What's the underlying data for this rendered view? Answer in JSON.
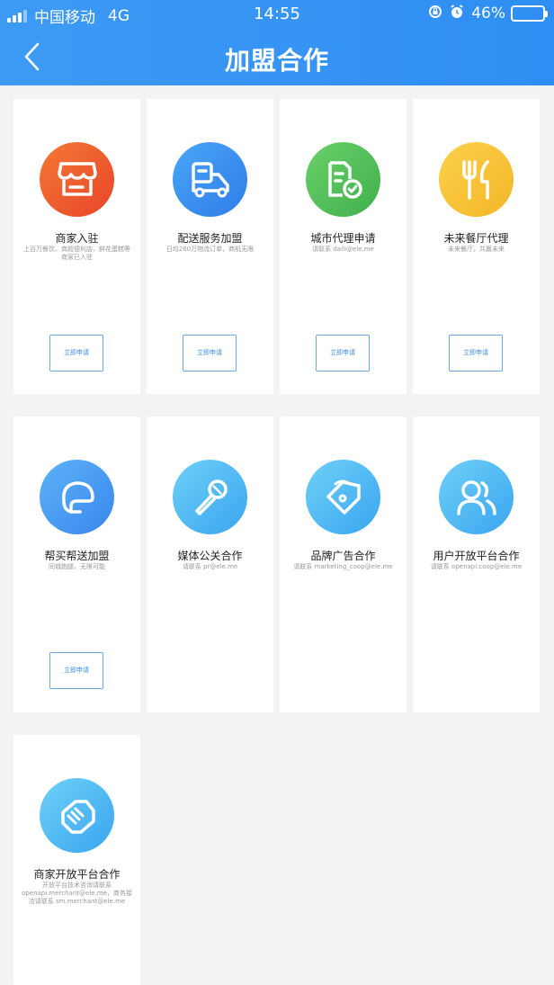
{
  "status_bar": {
    "carrier": "中国移动",
    "network": "4G",
    "time": "14:55",
    "battery_percent": "46%",
    "battery_level": 0.46
  },
  "header": {
    "title": "加盟合作"
  },
  "cards": [
    {
      "title": "商家入驻",
      "desc": "上百万餐饮、商超便利店、鲜花蛋糕等商家已入驻",
      "button": "立即申请",
      "icon": "storefront-icon",
      "color": "#ef5a2b"
    },
    {
      "title": "配送服务加盟",
      "desc": "日均260万物流订单，商机无限",
      "button": "立即申请",
      "icon": "delivery-scooter-icon",
      "color": "#3a8ef0"
    },
    {
      "title": "城市代理申请",
      "desc": "请联系 daili@ele.me",
      "button": "立即申请",
      "icon": "document-check-icon",
      "color": "#52c15a"
    },
    {
      "title": "未来餐厅代理",
      "desc": "未来餐厅，共赢未来",
      "button": "立即申请",
      "icon": "fork-knife-icon",
      "color": "#f7c431"
    },
    {
      "title": "帮买帮送加盟",
      "desc": "同城跑腿，无限可能",
      "button": "立即申请",
      "icon": "helmet-icon",
      "color": "#4a9cf3"
    },
    {
      "title": "媒体公关合作",
      "desc": "请联系 pr@ele.me",
      "icon": "microphone-icon",
      "color": "#4fb6f5"
    },
    {
      "title": "品牌广告合作",
      "desc": "请联系 marketing_coop@ele.me",
      "icon": "tag-icon",
      "color": "#4fb6f5"
    },
    {
      "title": "用户开放平台合作",
      "desc": "请联系 openapi.coop@ele.me",
      "icon": "users-icon",
      "color": "#4fb6f5"
    },
    {
      "title": "商家开放平台合作",
      "desc": "开放平台技术咨询请联系 openapi.merchant@ele.me，商务接洽请联系 sm.merchant@ele.me",
      "icon": "handshake-icon",
      "color": "#4fb6f5"
    }
  ]
}
